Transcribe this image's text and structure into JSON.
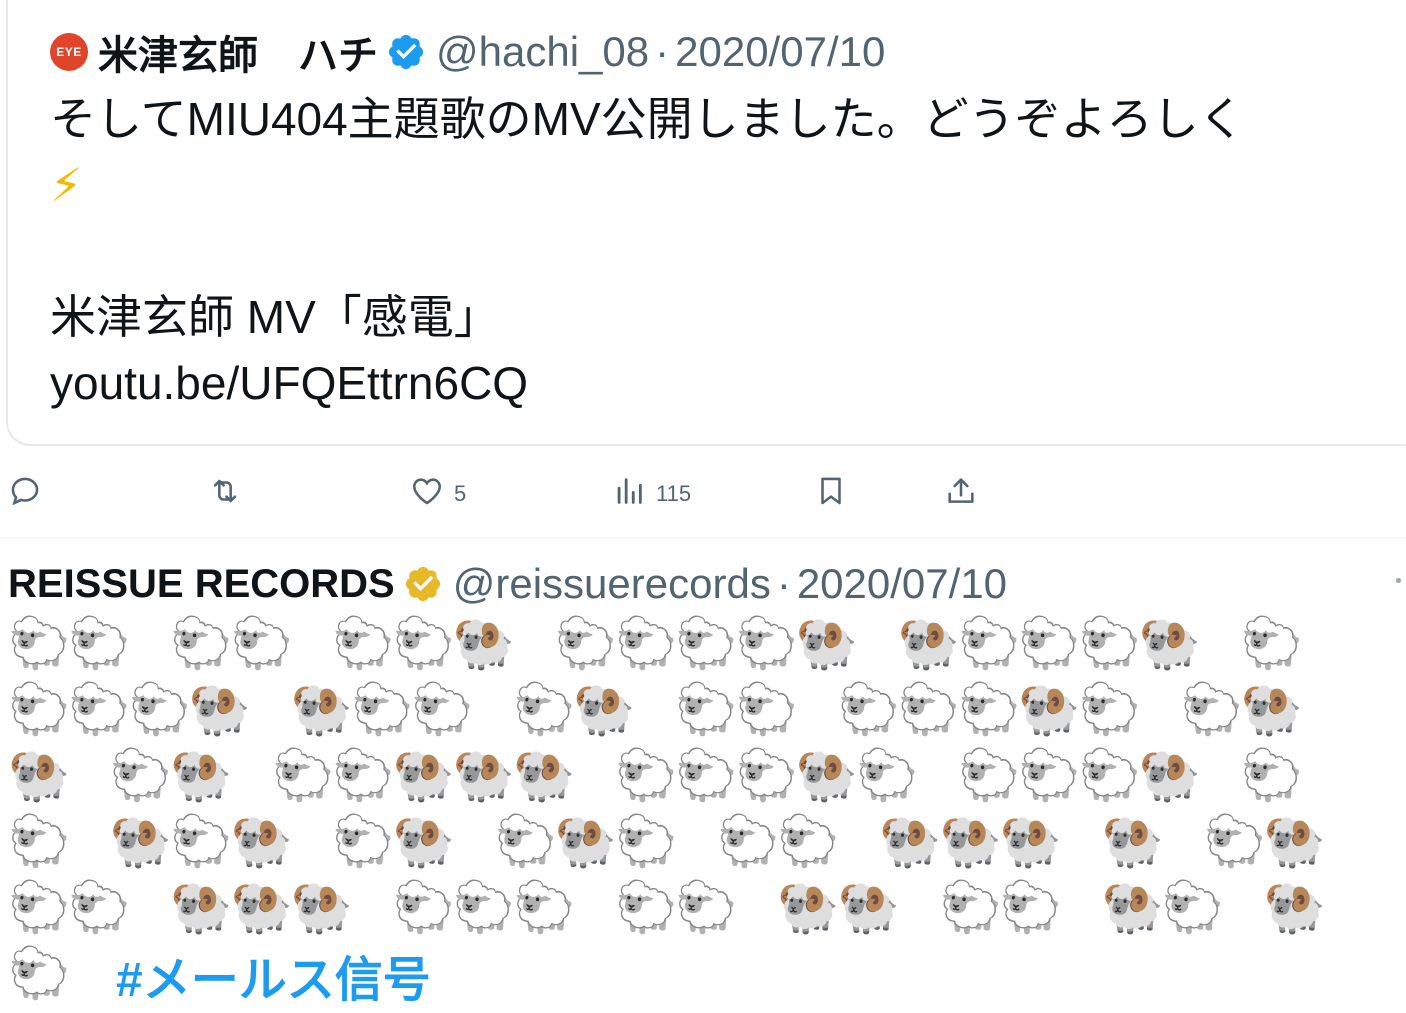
{
  "quoted_tweet": {
    "avatar_text": "EYE",
    "display_name": "米津玄師　ハチ",
    "handle": "@hachi_08",
    "date": "2020/07/10",
    "text_line1": "そしてMIU404主題歌のMV公開しました。どうぞよろしく",
    "text_line2": "⚡",
    "text_line3": "米津玄師 MV「感電」",
    "text_line4": "youtu.be/UFQEttrn6CQ"
  },
  "actions": {
    "reply_icon": "reply-icon",
    "retweet_icon": "retweet-icon",
    "like_icon": "heart-icon",
    "like_count": "5",
    "views_icon": "views-icon",
    "views_count": "115",
    "bookmark_icon": "bookmark-icon",
    "share_icon": "share-icon"
  },
  "tweet": {
    "display_name": "REISSUE RECORDS",
    "verified_color": "#e8b829",
    "handle": "@reissuerecords",
    "date": "2020/07/10",
    "sheep_rows": [
      "🐑🐑   🐑🐑   🐑🐑🐏   🐑🐑🐑🐑🐏   🐏🐑🐑🐑🐏   🐑",
      "🐑🐑🐑🐏   🐏🐑🐑   🐑🐏   🐑🐑   🐑🐑🐑🐏🐑   🐑🐏",
      "🐏   🐑🐏   🐑🐑🐏🐏🐏   🐑🐑🐑🐏🐑   🐑🐑🐑🐏   🐑",
      "🐑   🐏🐑🐏   🐑🐏   🐑🐏🐑   🐑🐑   🐏🐏🐏   🐏   🐑🐏",
      "🐑🐑   🐏🐏🐏   🐑🐑🐑   🐑🐑   🐏🐏   🐑🐑   🐏🐑   🐏"
    ],
    "sheep_last": "🐑",
    "hashtag": "#メールス信号"
  }
}
